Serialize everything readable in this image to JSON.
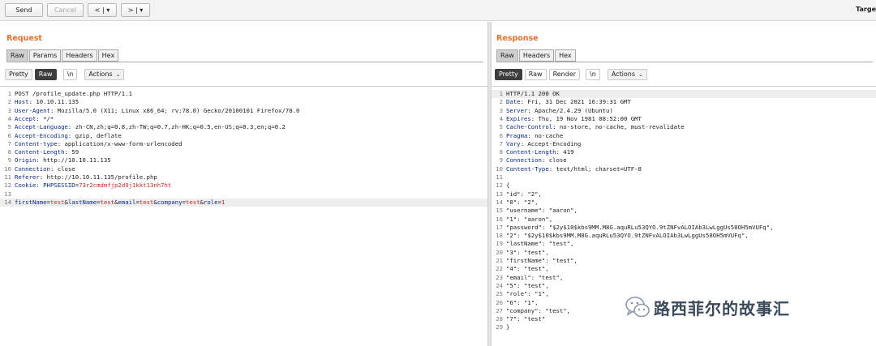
{
  "toolbar": {
    "send_label": "Send",
    "cancel_label": "Cancel",
    "back_label": "< | ▾",
    "forward_label": "> | ▾",
    "target_label": "Targe"
  },
  "request": {
    "title": "Request",
    "tabs": [
      "Raw",
      "Params",
      "Headers",
      "Hex"
    ],
    "active_tab": 0,
    "subbar": {
      "pretty": "Pretty",
      "raw": "Raw",
      "newline": "\\n",
      "actions": "Actions"
    },
    "lines": [
      [
        [
          "v",
          "POST /profile_update.php HTTP/1.1"
        ]
      ],
      [
        [
          "k",
          "Host"
        ],
        [
          "v",
          ": 10.10.11.135"
        ]
      ],
      [
        [
          "k",
          "User-Agent"
        ],
        [
          "v",
          ": Mozilla/5.0 (X11; Linux x86_64; rv:78.0) Gecko/20100101 Firefox/78.0"
        ]
      ],
      [
        [
          "k",
          "Accept"
        ],
        [
          "v",
          ": */*"
        ]
      ],
      [
        [
          "k",
          "Accept-Language"
        ],
        [
          "v",
          ": zh-CN,zh;q=0.8,zh-TW;q=0.7,zh-HK;q=0.5,en-US;q=0.3,en;q=0.2"
        ]
      ],
      [
        [
          "k",
          "Accept-Encoding"
        ],
        [
          "v",
          ": gzip, deflate"
        ]
      ],
      [
        [
          "k",
          "Content-type"
        ],
        [
          "v",
          ": application/x-www-form-urlencoded"
        ]
      ],
      [
        [
          "k",
          "Content-Length"
        ],
        [
          "v",
          ": 59"
        ]
      ],
      [
        [
          "k",
          "Origin"
        ],
        [
          "v",
          ": http://10.10.11.135"
        ]
      ],
      [
        [
          "k",
          "Connection"
        ],
        [
          "v",
          ": close"
        ]
      ],
      [
        [
          "k",
          "Referer"
        ],
        [
          "v",
          ": http://10.10.11.135/profile.php"
        ]
      ],
      [
        [
          "k",
          "Cookie"
        ],
        [
          "v",
          ": "
        ],
        [
          "b",
          "PHPSESSID"
        ],
        [
          "v",
          "="
        ],
        [
          "r",
          "73r2cmdmfjp2d9j1kkt13nh7ht"
        ]
      ],
      [
        [
          "v",
          ""
        ]
      ],
      [
        [
          "b",
          "firstName"
        ],
        [
          "v",
          "="
        ],
        [
          "r",
          "test"
        ],
        [
          "v",
          "&"
        ],
        [
          "b",
          "lastName"
        ],
        [
          "v",
          "="
        ],
        [
          "r",
          "test"
        ],
        [
          "v",
          "&"
        ],
        [
          "b",
          "email"
        ],
        [
          "v",
          "="
        ],
        [
          "r",
          "test"
        ],
        [
          "v",
          "&"
        ],
        [
          "b",
          "company"
        ],
        [
          "v",
          "="
        ],
        [
          "r",
          "test"
        ],
        [
          "v",
          "&"
        ],
        [
          "b",
          "role"
        ],
        [
          "v",
          "="
        ],
        [
          "r",
          "1"
        ]
      ]
    ],
    "highlight_line": 14
  },
  "response": {
    "title": "Response",
    "tabs": [
      "Raw",
      "Headers",
      "Hex"
    ],
    "active_tab": 0,
    "subbar": {
      "pretty": "Pretty",
      "raw": "Raw",
      "render": "Render",
      "newline": "\\n",
      "actions": "Actions"
    },
    "lines": [
      [
        [
          "v",
          "HTTP/1.1 200 OK"
        ]
      ],
      [
        [
          "k",
          "Date"
        ],
        [
          "v",
          ": Fri, 31 Dec 2021 16:39:31 GMT"
        ]
      ],
      [
        [
          "k",
          "Server"
        ],
        [
          "v",
          ": Apache/2.4.29 (Ubuntu)"
        ]
      ],
      [
        [
          "k",
          "Expires"
        ],
        [
          "v",
          ": Thu, 19 Nov 1981 08:52:00 GMT"
        ]
      ],
      [
        [
          "k",
          "Cache-Control"
        ],
        [
          "v",
          ": no-store, no-cache, must-revalidate"
        ]
      ],
      [
        [
          "k",
          "Pragma"
        ],
        [
          "v",
          ": no-cache"
        ]
      ],
      [
        [
          "k",
          "Vary"
        ],
        [
          "v",
          ": Accept-Encoding"
        ]
      ],
      [
        [
          "k",
          "Content-Length"
        ],
        [
          "v",
          ": 419"
        ]
      ],
      [
        [
          "k",
          "Connection"
        ],
        [
          "v",
          ": close"
        ]
      ],
      [
        [
          "k",
          "Content-Type"
        ],
        [
          "v",
          ": text/html; charset=UTF-8"
        ]
      ],
      [
        [
          "v",
          ""
        ]
      ],
      [
        [
          "v",
          "{"
        ]
      ],
      [
        [
          "v",
          "\"id\": \"2\","
        ]
      ],
      [
        [
          "v",
          "\"0\": \"2\","
        ]
      ],
      [
        [
          "v",
          "\"username\": \"aaron\","
        ]
      ],
      [
        [
          "v",
          "\"1\": \"aaron\","
        ]
      ],
      [
        [
          "v",
          "\"password\": \"$2y$10$kbs9MM.M8G.aquRLu53QYO.9tZNFvALOIAb3LwLggUs58OH5mVUFq\","
        ]
      ],
      [
        [
          "v",
          "\"2\": \"$2y$10$kbs9MM.M8G.aquRLu53QYO.9tZNFvALOIAb3LwLggUs58OH5mVUFq\","
        ]
      ],
      [
        [
          "v",
          "\"lastName\": \"test\","
        ]
      ],
      [
        [
          "v",
          "\"3\": \"test\","
        ]
      ],
      [
        [
          "v",
          "\"firstName\": \"test\","
        ]
      ],
      [
        [
          "v",
          "\"4\": \"test\","
        ]
      ],
      [
        [
          "v",
          "\"email\": \"test\","
        ]
      ],
      [
        [
          "v",
          "\"5\": \"test\","
        ]
      ],
      [
        [
          "v",
          "\"role\": \"1\","
        ]
      ],
      [
        [
          "v",
          "\"6\": \"1\","
        ]
      ],
      [
        [
          "v",
          "\"company\": \"test\","
        ]
      ],
      [
        [
          "v",
          "\"7\": \"test\""
        ]
      ],
      [
        [
          "v",
          "}"
        ]
      ]
    ],
    "highlight_line": 1
  },
  "watermark": {
    "text": "路西菲尔的故事汇",
    "icon": "wechat-icon"
  },
  "colors": {
    "title": "#e8702a",
    "key": "#0a2a8a",
    "value_red": "#c02a2a",
    "active_tab": "#cfcfcf"
  }
}
